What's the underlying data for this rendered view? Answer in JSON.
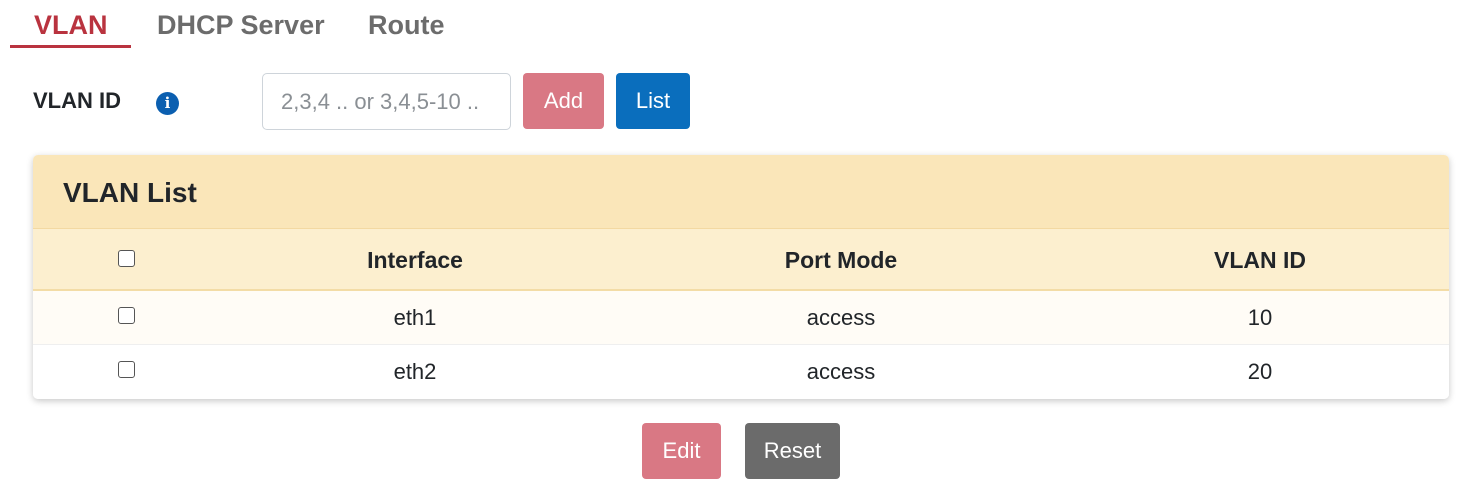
{
  "tabs": [
    {
      "label": "VLAN",
      "active": true
    },
    {
      "label": "DHCP Server",
      "active": false
    },
    {
      "label": "Route",
      "active": false
    }
  ],
  "vlan_form": {
    "label": "VLAN ID",
    "info_icon": "info-circle-icon",
    "input_value": "",
    "input_placeholder": "2,3,4 .. or 3,4,5-10 ..",
    "add_label": "Add",
    "list_label": "List"
  },
  "vlan_list": {
    "title": "VLAN List",
    "columns": [
      "Interface",
      "Port Mode",
      "VLAN ID"
    ],
    "rows": [
      {
        "interface": "eth1",
        "port_mode": "access",
        "vlan_id": "10"
      },
      {
        "interface": "eth2",
        "port_mode": "access",
        "vlan_id": "20"
      }
    ]
  },
  "actions": {
    "edit_label": "Edit",
    "reset_label": "Reset"
  },
  "colors": {
    "accent": "#b9333f",
    "primary": "#0a6ebd",
    "danger_muted": "#d97884",
    "secondary": "#6b6b6b",
    "card_header": "#fae6b9"
  }
}
